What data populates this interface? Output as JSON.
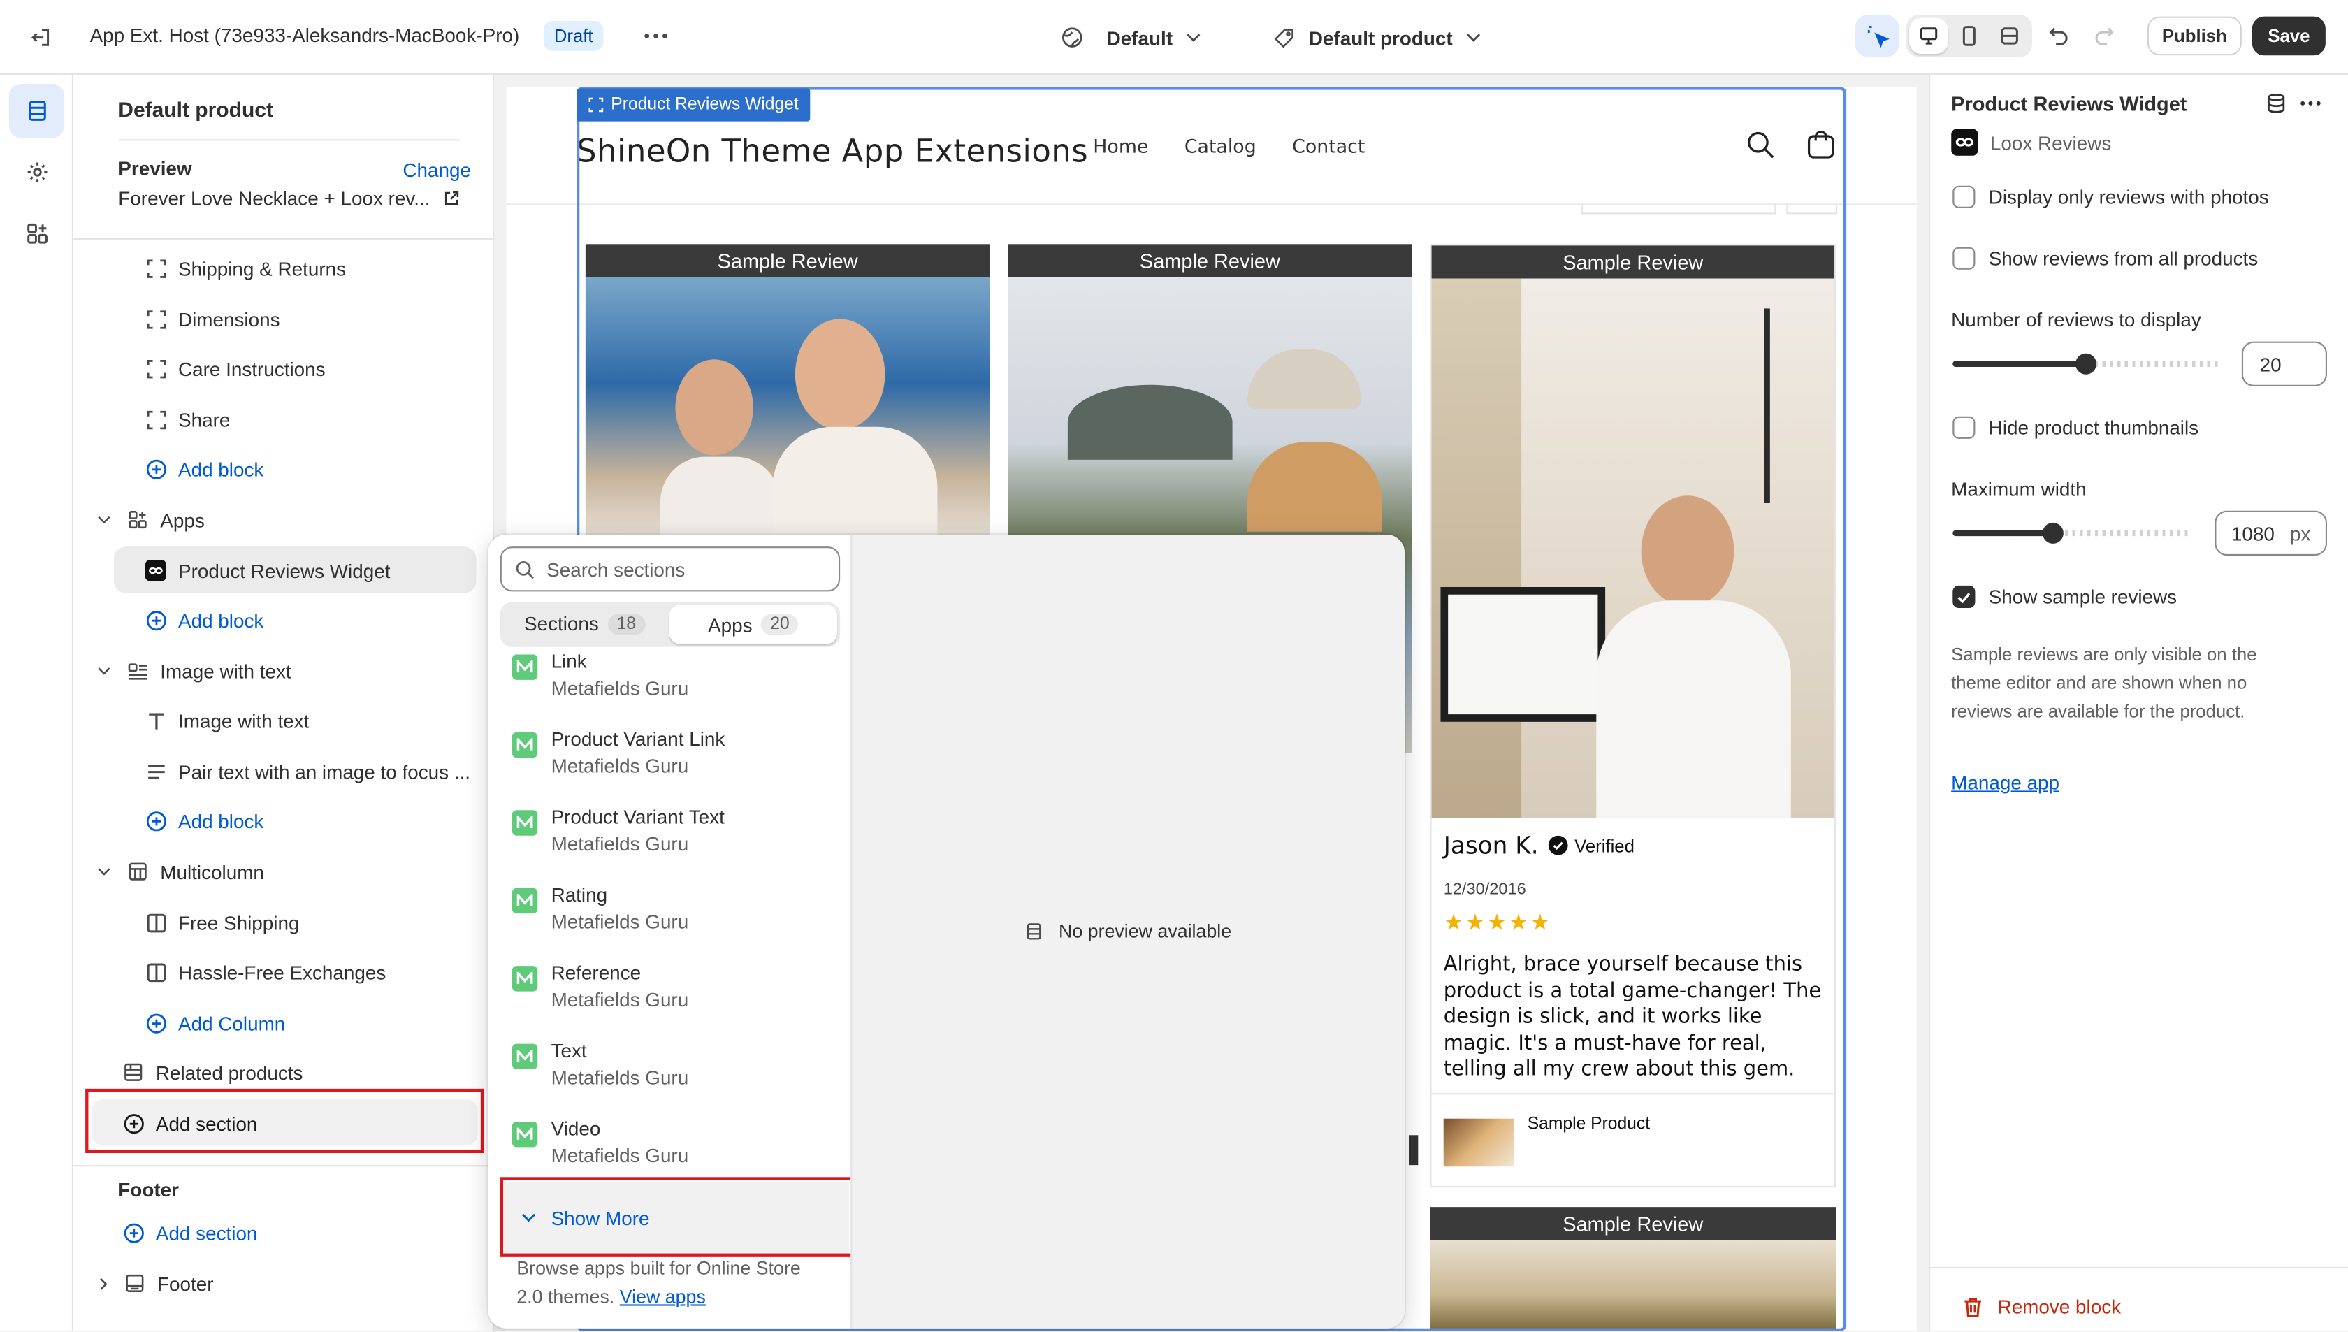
{
  "topbar": {
    "title": "App Ext. Host (73e933-Aleksandrs-MacBook-Pro)",
    "status_badge": "Draft",
    "theme_selector": "Default",
    "template_selector": "Default product",
    "publish_label": "Publish",
    "save_label": "Save"
  },
  "left_panel": {
    "heading": "Default product",
    "preview_label": "Preview",
    "change_label": "Change",
    "preview_value": "Forever Love Necklace + Loox rev...",
    "blocks": {
      "shipping": "Shipping & Returns",
      "dimensions": "Dimensions",
      "care": "Care Instructions",
      "share": "Share",
      "add_block_1": "Add block"
    },
    "apps_section": {
      "label": "Apps",
      "widget": "Product Reviews Widget",
      "add_block": "Add block"
    },
    "image_with_text_section": {
      "label": "Image with text",
      "heading_block": "Image with text",
      "text_block": "Pair text with an image to focus ...",
      "add_block": "Add block"
    },
    "multicolumn_section": {
      "label": "Multicolumn",
      "col1": "Free Shipping",
      "col2": "Hassle-Free Exchanges",
      "add_column": "Add Column"
    },
    "related_products": "Related products",
    "add_section": "Add section",
    "footer_group": {
      "heading": "Footer",
      "add_section": "Add section",
      "footer_item": "Footer"
    }
  },
  "canvas": {
    "widget_tag": "Product Reviews Widget",
    "store_name": "ShineOn Theme App Extensions",
    "nav": [
      "Home",
      "Catalog",
      "Contact"
    ],
    "review_header": "Sample Review",
    "review": {
      "author": "Jason K.",
      "verified": "Verified",
      "date": "12/30/2016",
      "rating": 5,
      "stars": "★★★★★",
      "text": "Alright, brace yourself because this product is a total game-changer! The design is slick, and it works like magic. It's a must-have for real, telling all my crew about this gem.",
      "product": "Sample Product"
    }
  },
  "popup": {
    "search_placeholder": "Search sections",
    "tab_sections": "Sections",
    "tab_sections_count": "18",
    "tab_apps": "Apps",
    "tab_apps_count": "20",
    "items": [
      {
        "name": "Link",
        "vendor": "Metafields Guru"
      },
      {
        "name": "Product Variant Link",
        "vendor": "Metafields Guru"
      },
      {
        "name": "Product Variant Text",
        "vendor": "Metafields Guru"
      },
      {
        "name": "Rating",
        "vendor": "Metafields Guru"
      },
      {
        "name": "Reference",
        "vendor": "Metafields Guru"
      },
      {
        "name": "Text",
        "vendor": "Metafields Guru"
      },
      {
        "name": "Video",
        "vendor": "Metafields Guru"
      }
    ],
    "show_more": "Show More",
    "footer_text": "Browse apps built for Online Store 2.0 themes.",
    "view_apps": "View apps",
    "no_preview": "No preview available"
  },
  "right_panel": {
    "title": "Product Reviews Widget",
    "app_name": "Loox Reviews",
    "opt_photos": "Display only reviews with photos",
    "opt_all_products": "Show reviews from all products",
    "num_reviews_label": "Number of reviews to display",
    "num_reviews_value": "20",
    "num_reviews_fraction": 0.5,
    "hide_thumbs": "Hide product thumbnails",
    "max_width_label": "Maximum width",
    "max_width_value": "1080",
    "max_width_unit": "px",
    "max_width_fraction": 0.42,
    "show_sample": "Show sample reviews",
    "show_sample_checked": true,
    "help_text": "Sample reviews are only visible on the theme editor and are shown when no reviews are available for the product.",
    "manage_app": "Manage app",
    "remove_block": "Remove block"
  },
  "colors": {
    "accent_blue": "#005bd3",
    "highlight_red": "#e0161e",
    "app_green": "#5fca7a",
    "remove_red": "#c5280c"
  }
}
